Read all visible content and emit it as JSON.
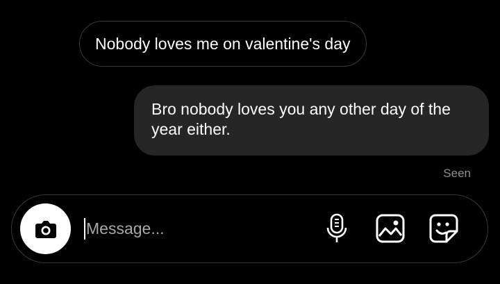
{
  "messages": [
    {
      "direction": "received",
      "text": "Nobody loves me on valentine's day"
    },
    {
      "direction": "sent",
      "text": "Bro nobody loves you any other day of the year either."
    }
  ],
  "status": {
    "seen_label": "Seen"
  },
  "composer": {
    "placeholder": "Message...",
    "value": "",
    "icons": {
      "camera": "camera-icon",
      "mic": "microphone-icon",
      "gallery": "image-gallery-icon",
      "sticker": "sticker-icon"
    }
  },
  "colors": {
    "background": "#000000",
    "sent_bubble": "#262626",
    "border": "#3a3a3a",
    "muted_text": "#8e8e8e"
  }
}
